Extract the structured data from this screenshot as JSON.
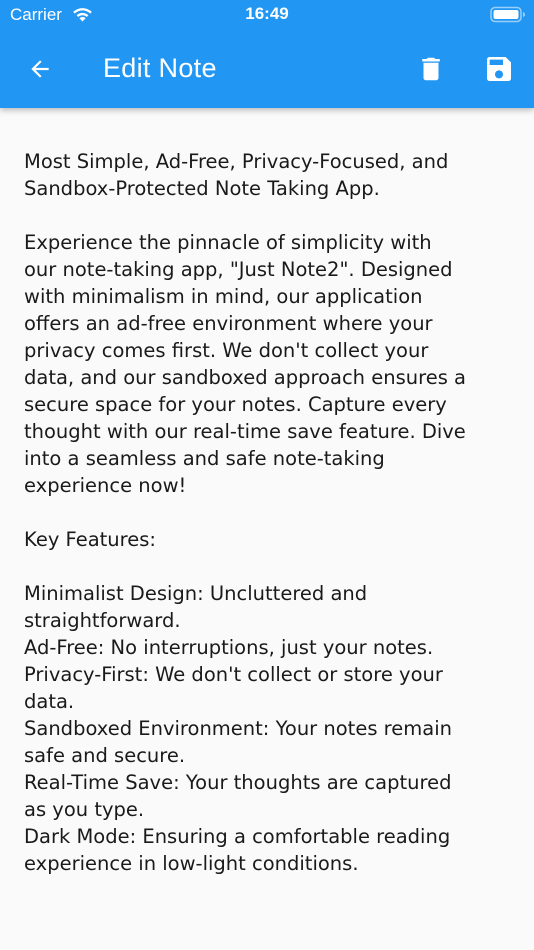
{
  "status_bar": {
    "carrier": "Carrier",
    "time": "16:49",
    "wifi_icon": "wifi-icon",
    "battery_icon": "battery-full-icon"
  },
  "app_bar": {
    "title": "Edit Note",
    "background_color": "#2196f3",
    "back_icon": "arrow-back-icon",
    "delete_icon": "trash-icon",
    "save_icon": "floppy-disk-icon"
  },
  "note": {
    "lines": [
      "Most Simple, Ad-Free, Privacy-Focused, and",
      "Sandbox-Protected Note Taking App.",
      "",
      "Experience the pinnacle of simplicity with",
      "our note-taking app, \"Just Note2\". Designed",
      "with minimalism in mind, our application",
      "offers an ad-free environment where your",
      "privacy comes first. We don't collect your",
      "data, and our sandboxed approach ensures a",
      "secure space for your notes. Capture every",
      "thought with our real-time save feature. Dive",
      "into a seamless and safe note-taking",
      "experience now!",
      "",
      "Key Features:",
      "",
      "Minimalist Design: Uncluttered and",
      "straightforward.",
      "Ad-Free: No interruptions, just your notes.",
      "Privacy-First: We don't collect or store your",
      "data.",
      "Sandboxed Environment: Your notes remain",
      "safe and secure.",
      "Real-Time Save: Your thoughts are captured",
      "as you type.",
      "Dark Mode: Ensuring a comfortable reading",
      "experience in low-light conditions."
    ]
  }
}
